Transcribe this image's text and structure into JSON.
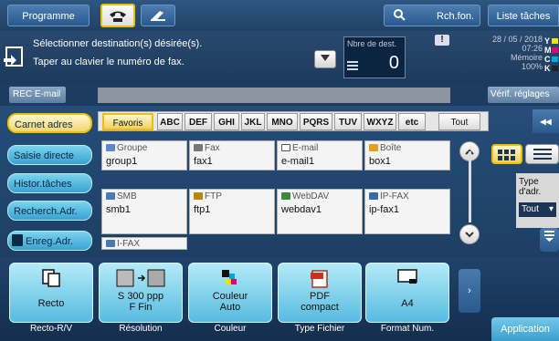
{
  "topbar": {
    "programme": "Programme",
    "search": "Rch.fon.",
    "jobs": "Liste tâches"
  },
  "info": {
    "line1": "Sélectionner destination(s) désirée(s).",
    "line2": "Taper au clavier le numéro de fax.",
    "dest_label": "Nbre de dest.",
    "dest_count": "0",
    "date": "28 / 05 / 2018",
    "time": "07:26",
    "memory_label": "Mémoire",
    "memory_value": "100%",
    "toner": [
      {
        "letter": "Y",
        "color": "#f2e200"
      },
      {
        "letter": "M",
        "color": "#e2007a"
      },
      {
        "letter": "C",
        "color": "#00a5e0"
      },
      {
        "letter": "K",
        "color": "#222222"
      }
    ]
  },
  "row2": {
    "rec_email": "REC E-mail",
    "verify": "Vérif. réglages"
  },
  "left_nav": [
    {
      "label": "Carnet adres",
      "active": true
    },
    {
      "label": "Saisie directe",
      "active": false
    },
    {
      "label": "Histor.tâches",
      "active": false
    },
    {
      "label": "Recherch.Adr.",
      "active": false
    },
    {
      "label": "Enreg.Adr.",
      "active": false
    }
  ],
  "tabs": [
    "Favoris",
    "ABC",
    "DEF",
    "GHI",
    "JKL",
    "MNO",
    "PQRS",
    "TUV",
    "WXYZ",
    "etc",
    "Tout"
  ],
  "cards": [
    {
      "type": "Groupe",
      "name": "group1",
      "icon": "group-icon"
    },
    {
      "type": "Fax",
      "name": "fax1",
      "icon": "fax-icon"
    },
    {
      "type": "E-mail",
      "name": "e-mail1",
      "icon": "email-icon"
    },
    {
      "type": "Boîte",
      "name": "box1",
      "icon": "box-icon"
    },
    {
      "type": "SMB",
      "name": "smb1",
      "icon": "smb-icon"
    },
    {
      "type": "FTP",
      "name": "ftp1",
      "icon": "ftp-icon"
    },
    {
      "type": "WebDAV",
      "name": "webdav1",
      "icon": "webdav-icon"
    },
    {
      "type": "IP-FAX",
      "name": "ip-fax1",
      "icon": "ip-fax-icon"
    },
    {
      "type": "I-FAX",
      "name": "",
      "icon": "i-fax-icon"
    }
  ],
  "type_adr": {
    "label": "Type d'adr.",
    "value": "Tout"
  },
  "functions": [
    {
      "value": "Recto",
      "label": "Recto-R/V",
      "icon": "duplex-icon"
    },
    {
      "value": "S 300 ppp\nF Fin",
      "label": "Résolution",
      "icon": "resolution-icon"
    },
    {
      "value": "Couleur\nAuto",
      "label": "Couleur",
      "icon": "color-icon"
    },
    {
      "value": "PDF\ncompact",
      "label": "Type Fichier",
      "icon": "pdf-icon"
    },
    {
      "value": "A4",
      "label": "Format Num.",
      "icon": "paper-size-icon"
    }
  ],
  "application": "Application"
}
